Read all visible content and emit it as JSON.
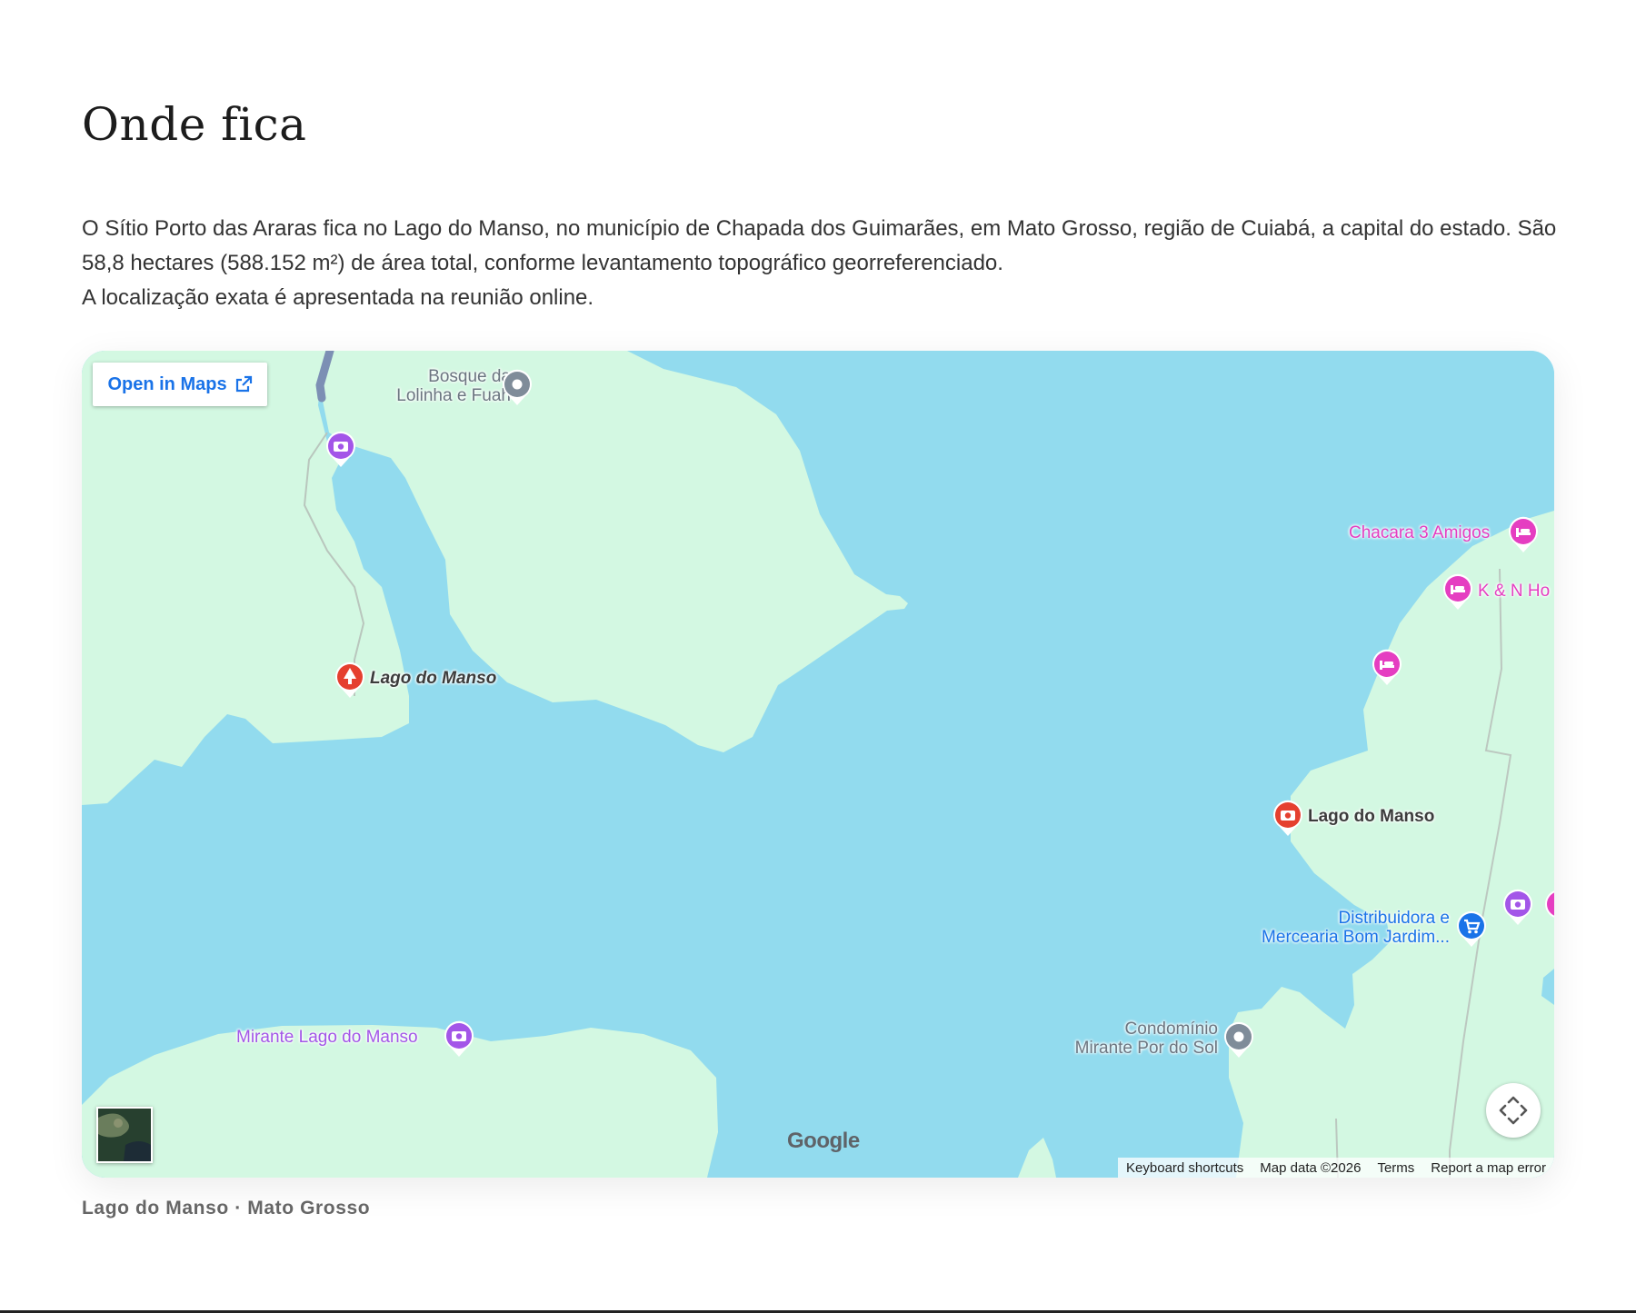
{
  "section": {
    "title": "Onde fica",
    "paragraphs": [
      "O Sítio Porto das Araras fica no Lago do Manso, no município de Chapada dos Guimarães, em Mato Grosso, região de Cuiabá, a capital do estado. São 58,8 hectares (588.152 m²) de área total, conforme levantamento topográfico georreferenciado.",
      "A localização exata é apresentada na reunião online."
    ],
    "caption": "Lago do Manso · Mato Grosso"
  },
  "map": {
    "open_in_maps": "Open in Maps",
    "labels": {
      "bosque_line1": "Bosque da",
      "bosque_line2": "Lolinha e Fuah",
      "chacara": "Chacara 3 Amigos",
      "kn": "K & N Ho",
      "lago_manso_park": "Lago do Manso",
      "lago_manso_photo": "Lago do Manso",
      "distribuidora_line1": "Distribuidora e",
      "distribuidora_line2": "Mercearia Bom Jardim...",
      "mirante": "Mirante Lago do Manso",
      "condominio_line1": "Condomínio",
      "condominio_line2": "Mirante Por do Sol"
    },
    "google_logo": "Google",
    "attribution": {
      "keyboard": "Keyboard shortcuts",
      "data": "Map data ©2026",
      "terms": "Terms",
      "report": "Report a map error"
    },
    "colors": {
      "water": "#92dbee",
      "land": "#d3f8e2",
      "photo_poi": "#a356e8",
      "lodging_poi": "#e53ec1",
      "park_poi": "#e5402f",
      "shop_poi": "#1a73e8",
      "generic_poi": "#7f8c99"
    }
  }
}
